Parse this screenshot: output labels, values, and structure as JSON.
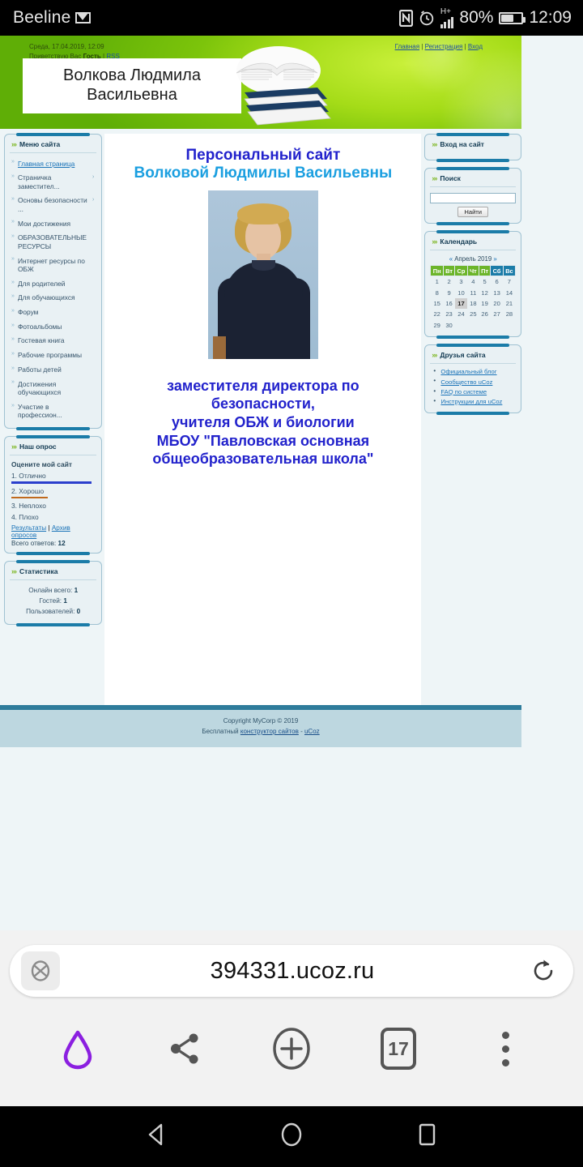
{
  "status_bar": {
    "carrier": "Beeline",
    "mail_icon": "mail-icon",
    "nfc_icon": "nfc-icon",
    "alarm_icon": "alarm-icon",
    "network_type": "H+",
    "battery_percent": "80%",
    "clock": "12:09"
  },
  "site": {
    "header": {
      "datetime": "Среда, 17.04.2019, 12:09",
      "greeting_prefix": "Приветствую Вас",
      "greeting_user": "Гость",
      "rss_label": "RSS",
      "separator": "|",
      "top_links": [
        "Главная",
        "Регистрация",
        "Вход"
      ],
      "site_title": "Волкова Людмила Васильевна"
    },
    "sidebar_left": {
      "menu_block": {
        "title": "Меню сайта",
        "items": [
          {
            "label": "Главная страница",
            "active": true,
            "submenu": false
          },
          {
            "label": "Страничка заместител...",
            "active": false,
            "submenu": true
          },
          {
            "label": "Основы безопасности ...",
            "active": false,
            "submenu": true
          },
          {
            "label": "Мои достижения",
            "active": false,
            "submenu": false
          },
          {
            "label": "ОБРАЗОВАТЕЛЬНЫЕ РЕСУРСЫ",
            "active": false,
            "submenu": false
          },
          {
            "label": "Интернет ресурсы по ОБЖ",
            "active": false,
            "submenu": false
          },
          {
            "label": "Для родителей",
            "active": false,
            "submenu": false
          },
          {
            "label": "Для обучающихся",
            "active": false,
            "submenu": false
          },
          {
            "label": "Форум",
            "active": false,
            "submenu": false
          },
          {
            "label": "Фотоальбомы",
            "active": false,
            "submenu": false
          },
          {
            "label": "Гостевая книга",
            "active": false,
            "submenu": false
          },
          {
            "label": "Рабочие программы",
            "active": false,
            "submenu": false
          },
          {
            "label": "Работы детей",
            "active": false,
            "submenu": false
          },
          {
            "label": "Достижения обучающихся",
            "active": false,
            "submenu": false
          },
          {
            "label": "Участие в профессион...",
            "active": false,
            "submenu": false
          }
        ]
      },
      "poll_block": {
        "title": "Наш опрос",
        "question": "Оцените мой сайт",
        "options": [
          {
            "label": "1. Отлично",
            "bar_color": "#2b3fcc",
            "bar_width": "92%"
          },
          {
            "label": "2. Хорошо",
            "bar_color": "#c06a1e",
            "bar_width": "42%"
          },
          {
            "label": "3. Неплохо",
            "bar_color": "",
            "bar_width": "0%"
          },
          {
            "label": "4. Плохо",
            "bar_color": "",
            "bar_width": "0%"
          }
        ],
        "results_link": "Результаты",
        "archive_link": "Архив опросов",
        "separator": "|",
        "total_label": "Всего ответов:",
        "total_value": "12"
      },
      "stats_block": {
        "title": "Статистика",
        "rows": [
          {
            "label": "Онлайн всего:",
            "value": "1"
          },
          {
            "label": "Гостей:",
            "value": "1"
          },
          {
            "label": "Пользователей:",
            "value": "0"
          }
        ]
      }
    },
    "sidebar_right": {
      "login_block": {
        "title": "Вход на сайт"
      },
      "search_block": {
        "title": "Поиск",
        "input_value": "",
        "input_placeholder": "",
        "button_label": "Найти"
      },
      "calendar_block": {
        "title": "Календарь",
        "prev_arrow": "«",
        "next_arrow": "»",
        "month_label": "Апрель 2019",
        "weekday_headers": [
          "Пн",
          "Вт",
          "Ср",
          "Чт",
          "Пт",
          "Сб",
          "Вс"
        ],
        "weekend_indexes": [
          5,
          6
        ],
        "today": "17",
        "weeks": [
          [
            "1",
            "2",
            "3",
            "4",
            "5",
            "6",
            "7"
          ],
          [
            "8",
            "9",
            "10",
            "11",
            "12",
            "13",
            "14"
          ],
          [
            "15",
            "16",
            "17",
            "18",
            "19",
            "20",
            "21"
          ],
          [
            "22",
            "23",
            "24",
            "25",
            "26",
            "27",
            "28"
          ],
          [
            "29",
            "30",
            "",
            "",
            "",
            "",
            ""
          ]
        ]
      },
      "friends_block": {
        "title": "Друзья сайта",
        "links": [
          "Официальный блог",
          "Сообщество uCoz",
          "FAQ по системе",
          "Инструкции для uCoz"
        ]
      }
    },
    "main": {
      "heading_line1": "Персональный сайт",
      "heading_line2": "Волковой Людмилы Васильевны",
      "photo_alt": "portrait-photo",
      "subheading_lines": [
        "заместителя директора по",
        "безопасности,",
        "учителя ОБЖ и биологии",
        "МБОУ \"Павловская основная",
        "общеобразовательная школа\""
      ]
    },
    "footer": {
      "copyright": "Copyright MyCorp © 2019",
      "free_prefix": "Бесплатный",
      "builder_link": "конструктор сайтов",
      "dash": "-",
      "ucoz_link": "uCoz"
    }
  },
  "browser": {
    "shield_icon": "blocked-content-icon",
    "url": "394331.ucoz.ru",
    "reload_icon": "reload-icon",
    "toolbar": [
      {
        "name": "home-logo-icon",
        "label": ""
      },
      {
        "name": "share-icon",
        "label": ""
      },
      {
        "name": "new-tab-plus-icon",
        "label": ""
      },
      {
        "name": "tab-counter",
        "label": "17"
      },
      {
        "name": "overflow-menu-icon",
        "label": ""
      }
    ]
  },
  "nav_bar": {
    "back_icon": "back-triangle-icon",
    "home_icon": "home-circle-icon",
    "recents_icon": "recents-square-icon"
  },
  "colors": {
    "banner_green": "#8ccf12",
    "accent_blue": "#1b7ca8",
    "heading_blue": "#2222cc",
    "heading_cyan": "#1b9fe0",
    "calendar_weekday": "#6cb52a",
    "calendar_weekend": "#1b7ca8",
    "footer_bg": "#bdd7e0"
  }
}
